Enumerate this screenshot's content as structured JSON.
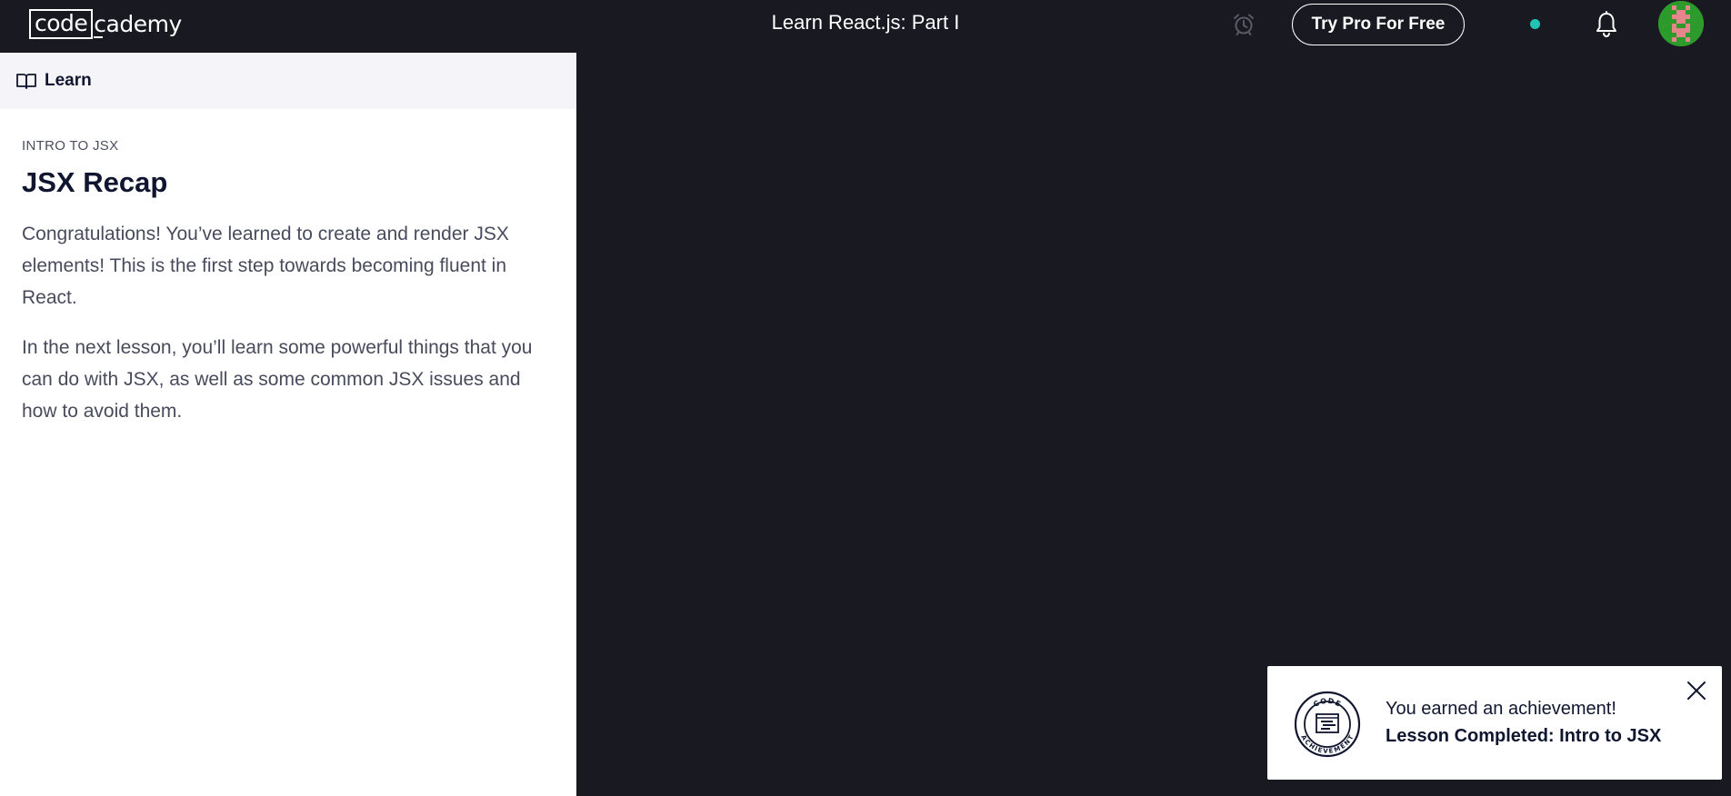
{
  "header": {
    "logo_boxed": "code",
    "logo_rest": "cademy",
    "course_title": "Learn React.js: Part I",
    "pro_button_label": "Try Pro For Free",
    "status_color": "#1fc4b4",
    "icons": [
      "alarm-clock-icon",
      "bell-icon",
      "avatar"
    ]
  },
  "sidebar": {
    "tab_label": "Learn",
    "tab_icon": "book-icon",
    "eyebrow": "INTRO TO JSX",
    "title": "JSX Recap",
    "paragraphs": [
      "Congratulations! You’ve learned to create and render JSX elements! This is the first step towards becoming fluent in React.",
      "In the next lesson, you’ll learn some powerful things that you can do with JSX, as well as some common JSX issues and how to avoid them."
    ]
  },
  "toast": {
    "line1": "You earned an achievement!",
    "line2": "Lesson Completed: Intro to JSX",
    "badge_text": "CODE ACHIEVEMENT",
    "badge_icon": "achievement-badge-icon",
    "close_icon": "close-icon"
  },
  "colors": {
    "background": "#191922",
    "panel": "#ffffff",
    "tab_background": "#f5f5f9",
    "text_dark": "#10162f",
    "text_body": "#484b5c",
    "avatar_green": "#2c9b2c",
    "avatar_pink": "#e6858c"
  }
}
